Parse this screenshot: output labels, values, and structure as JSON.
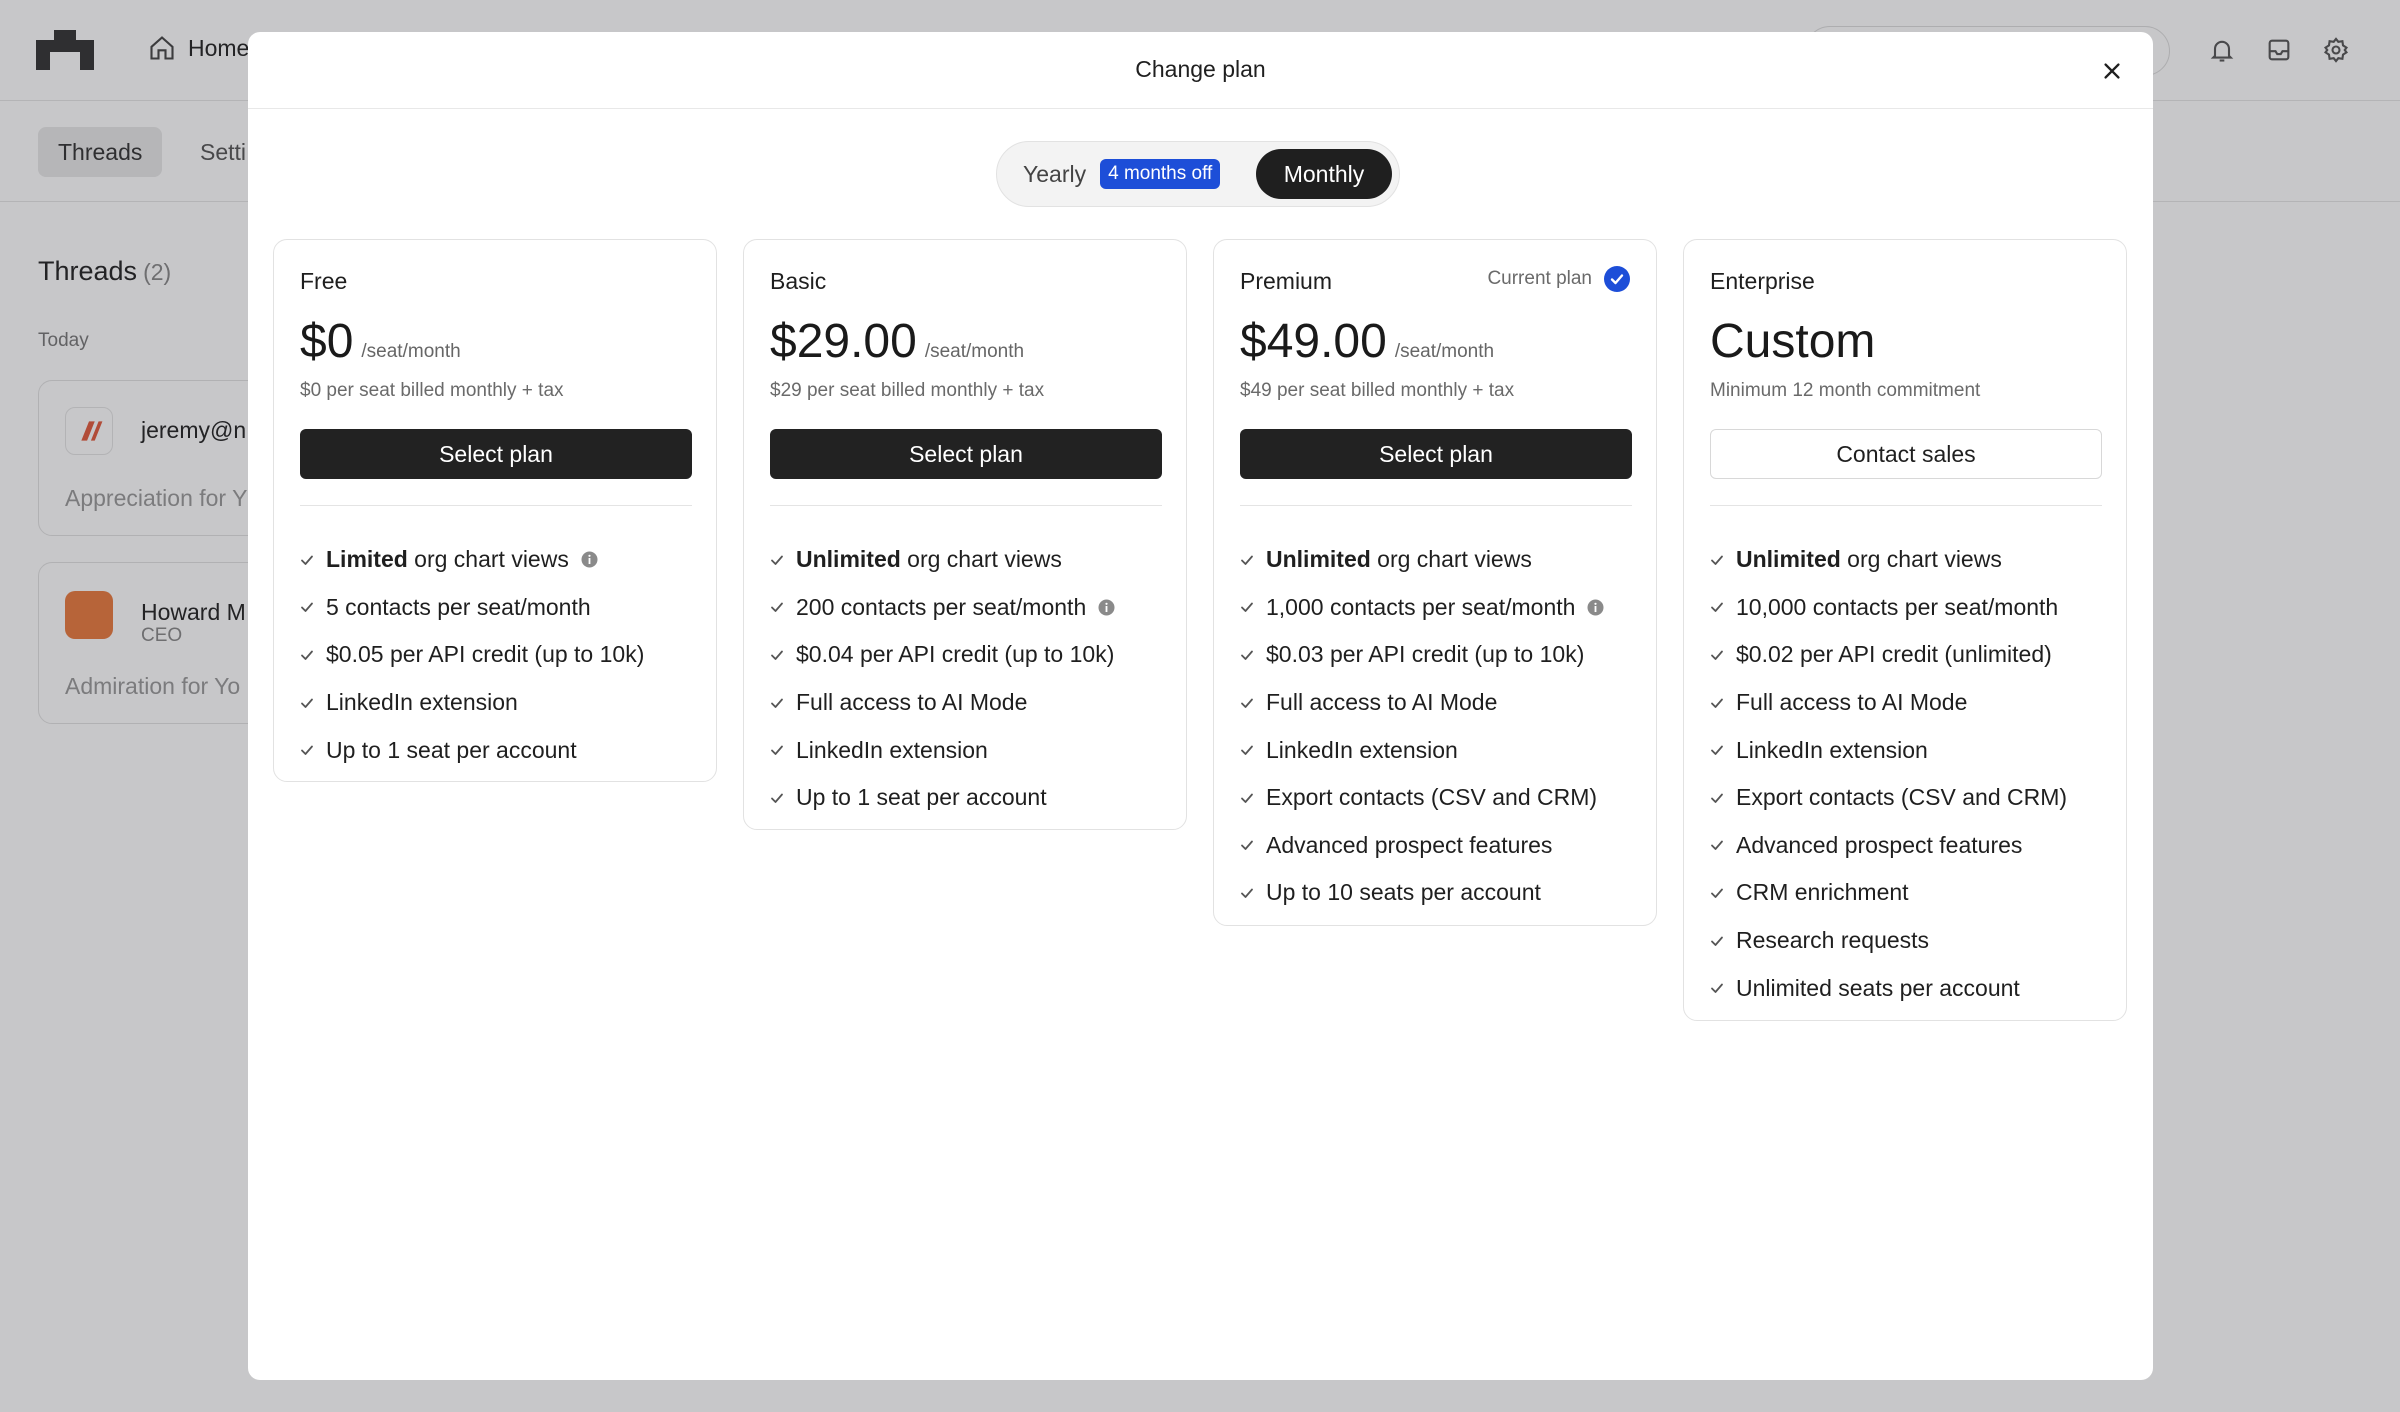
{
  "background": {
    "nav": {
      "home": "Home"
    },
    "tabs": [
      "Threads",
      "Setti"
    ],
    "threads": {
      "title": "Threads",
      "count": "(2)",
      "group": "Today"
    },
    "cards": [
      {
        "name": "jeremy@n",
        "subtitle": "",
        "preview": "Appreciation for Y"
      },
      {
        "name": "Howard M",
        "subtitle": "CEO",
        "preview": "Admiration for Yo"
      }
    ]
  },
  "modal": {
    "title": "Change plan",
    "billing": {
      "yearly": "Yearly",
      "discount": "4 months off",
      "monthly": "Monthly",
      "selected": "Monthly"
    },
    "plans": [
      {
        "name": "Free",
        "price": "$0",
        "unit": "/seat/month",
        "note": "$0 per seat billed monthly + tax",
        "cta": "Select plan",
        "features": [
          {
            "bold": "Limited",
            "text": " org chart views",
            "info": true
          },
          {
            "bold": "",
            "text": "5 contacts per seat/month",
            "info": false
          },
          {
            "bold": "",
            "text": "$0.05 per API credit (up to 10k)",
            "info": false
          },
          {
            "bold": "",
            "text": "LinkedIn extension",
            "info": false
          },
          {
            "bold": "",
            "text": "Up to 1 seat per account",
            "info": false
          }
        ]
      },
      {
        "name": "Basic",
        "price": "$29.00",
        "unit": "/seat/month",
        "note": "$29 per seat billed monthly + tax",
        "cta": "Select plan",
        "features": [
          {
            "bold": "Unlimited",
            "text": " org chart views",
            "info": false
          },
          {
            "bold": "",
            "text": "200 contacts per seat/month",
            "info": true
          },
          {
            "bold": "",
            "text": "$0.04 per API credit (up to 10k)",
            "info": false
          },
          {
            "bold": "",
            "text": "Full access to AI Mode",
            "info": false
          },
          {
            "bold": "",
            "text": "LinkedIn extension",
            "info": false
          },
          {
            "bold": "",
            "text": "Up to 1 seat per account",
            "info": false
          }
        ]
      },
      {
        "name": "Premium",
        "current_label": "Current plan",
        "price": "$49.00",
        "unit": "/seat/month",
        "note": "$49 per seat billed monthly + tax",
        "cta": "Select plan",
        "features": [
          {
            "bold": "Unlimited",
            "text": " org chart views",
            "info": false
          },
          {
            "bold": "",
            "text": "1,000 contacts per seat/month",
            "info": true
          },
          {
            "bold": "",
            "text": "$0.03 per API credit (up to 10k)",
            "info": false
          },
          {
            "bold": "",
            "text": "Full access to AI Mode",
            "info": false
          },
          {
            "bold": "",
            "text": "LinkedIn extension",
            "info": false
          },
          {
            "bold": "",
            "text": "Export contacts (CSV and CRM)",
            "info": false
          },
          {
            "bold": "",
            "text": "Advanced prospect features",
            "info": false
          },
          {
            "bold": "",
            "text": "Up to 10 seats per account",
            "info": false
          }
        ]
      },
      {
        "name": "Enterprise",
        "price": "Custom",
        "unit": "",
        "note": "Minimum 12 month commitment",
        "cta": "Contact sales",
        "features": [
          {
            "bold": "Unlimited",
            "text": " org chart views",
            "info": false
          },
          {
            "bold": "",
            "text": "10,000 contacts per seat/month",
            "info": false
          },
          {
            "bold": "",
            "text": "$0.02 per API credit (unlimited)",
            "info": false
          },
          {
            "bold": "",
            "text": "Full access to AI Mode",
            "info": false
          },
          {
            "bold": "",
            "text": "LinkedIn extension",
            "info": false
          },
          {
            "bold": "",
            "text": "Export contacts (CSV and CRM)",
            "info": false
          },
          {
            "bold": "",
            "text": "Advanced prospect features",
            "info": false
          },
          {
            "bold": "",
            "text": "CRM enrichment",
            "info": false
          },
          {
            "bold": "",
            "text": "Research requests",
            "info": false
          },
          {
            "bold": "",
            "text": "Unlimited seats per account",
            "info": false
          }
        ]
      }
    ]
  },
  "colors": {
    "accent": "#1d4ed8",
    "button_dark": "#222222",
    "overlay": "#28282e"
  },
  "icons": [
    "app-logo-icon",
    "home-icon",
    "bell-icon",
    "inbox-icon",
    "gear-icon",
    "close-icon",
    "check-icon",
    "info-icon",
    "check-circle-icon"
  ]
}
